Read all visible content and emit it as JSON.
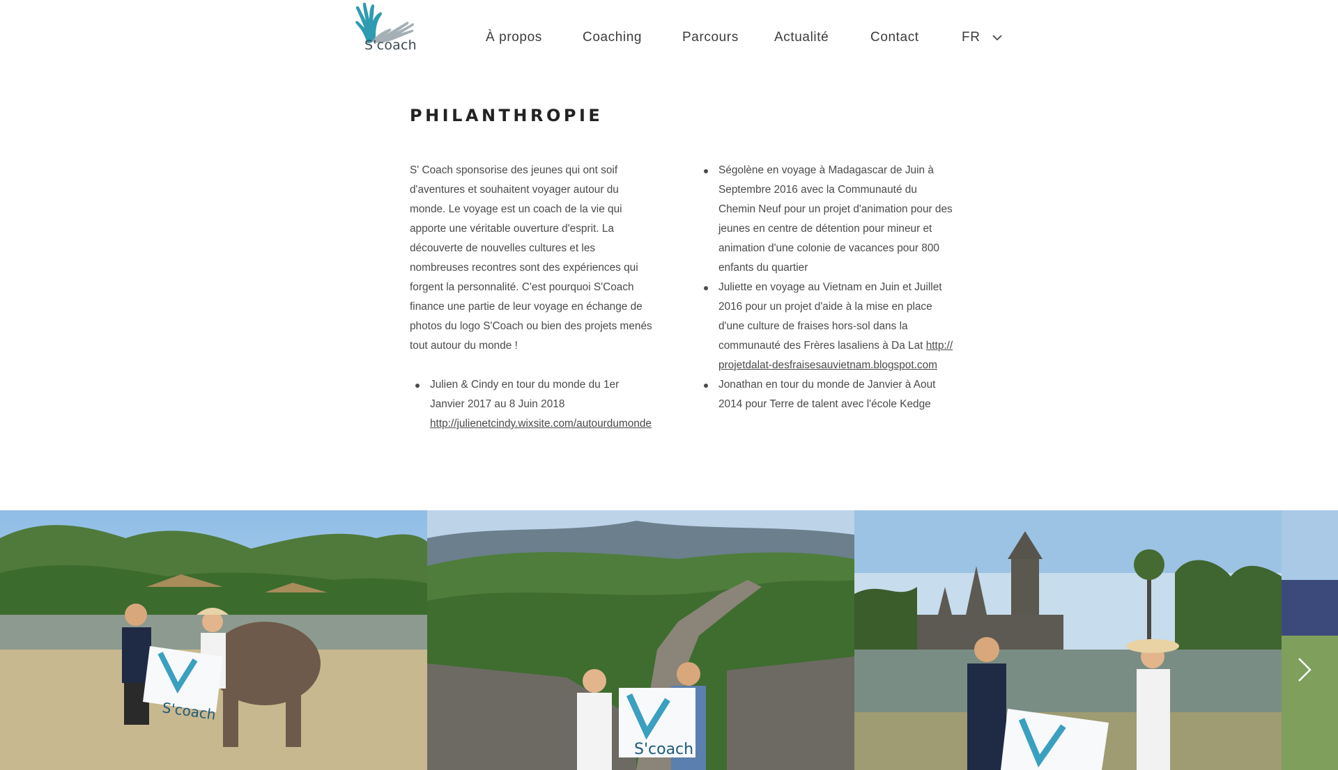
{
  "header": {
    "logo_text": "S'coach",
    "nav": [
      {
        "label": "À propos"
      },
      {
        "label": "Coaching"
      },
      {
        "label": "Parcours"
      },
      {
        "label": "Actualité"
      },
      {
        "label": "Contact"
      }
    ],
    "language": "FR"
  },
  "main": {
    "title": "PHILANTHROPIE",
    "intro": "S' Coach sponsorise des jeunes qui ont soif d'aventures et souhaitent voyager autour du monde. Le voyage est un coach de la vie qui apporte une véritable ouverture d'esprit. La découverte de nouvelles cultures et les nombreuses recontres sont des expériences qui forgent la personnalité. C'est pourquoi S'Coach finance une partie de leur voyage en échange de photos du logo S'Coach ou bien des projets menés tout autour du monde !",
    "left_items": [
      {
        "text": "Julien & Cindy en tour du monde du 1er Janvier 2017 au 8 Juin 2018",
        "link": "http://julienetcindy.wixsite.com/autourdumonde"
      }
    ],
    "right_items": [
      {
        "text": "Ségolène en voyage à Madagascar de Juin à Septembre 2016 avec la Communauté du Chemin Neuf pour un projet d'animation pour des jeunes en centre de détention pour mineur et animation d'une colonie de vacances pour 800 enfants du quartier",
        "link": ""
      },
      {
        "text": "Juliette en voyage au Vietnam en Juin et Juillet 2016 pour un projet d'aide à la mise en place d'une culture de fraises hors-sol dans la communauté des Frères lasaliens à Da Lat ",
        "link": "http://projetdalat-desfraisesauvietnam.blogspot.com"
      },
      {
        "text": "Jonathan en tour du monde de Janvier à Aout 2014 pour Terre de talent avec l'école Kedge",
        "link": ""
      }
    ]
  },
  "gallery": {
    "flag_text": "S'coach",
    "next_icon": "chevron-right-icon"
  },
  "colors": {
    "logo_teal": "#2e9bb0",
    "logo_gray": "#9aa7ad",
    "text": "#4a4a4a",
    "title": "#222222"
  }
}
